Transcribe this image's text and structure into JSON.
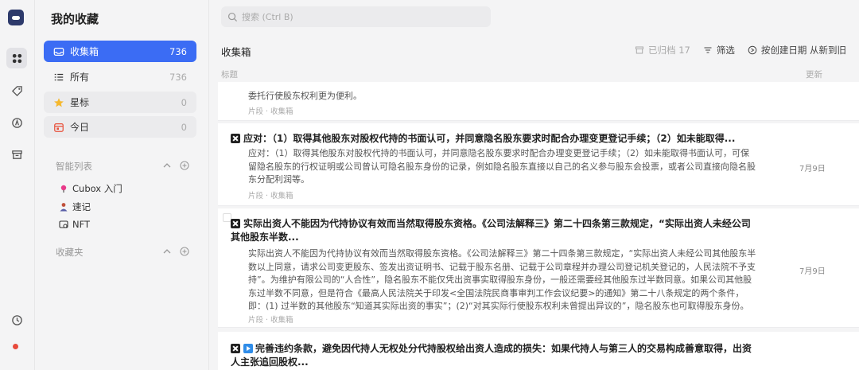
{
  "sidebar": {
    "title": "我的收藏",
    "items": [
      {
        "label": "收集箱",
        "count": "736"
      },
      {
        "label": "所有",
        "count": "736"
      },
      {
        "label": "星标",
        "count": "0"
      },
      {
        "label": "今日",
        "count": "0"
      }
    ],
    "smart_list_title": "智能列表",
    "smart_lists": [
      {
        "label": "Cubox 入门",
        "icon": "pin-icon"
      },
      {
        "label": "速记",
        "icon": "person-icon"
      },
      {
        "label": "NFT",
        "icon": "nft-icon"
      }
    ],
    "folders_title": "收藏夹"
  },
  "search": {
    "placeholder": "搜索 (Ctrl B)"
  },
  "main": {
    "title": "收集箱",
    "toolbar": {
      "archived": "已归档 17",
      "filter": "筛选",
      "sort": "按创建日期 从新到旧"
    },
    "col_title": "标题",
    "col_updated": "更新"
  },
  "cards": [
    {
      "body_partial": "委托行使股东权利更为便利。",
      "meta": "片段 · 收集箱"
    },
    {
      "title": "应对：（1）取得其他股东对股权代持的书面认可，并同意隐名股东要求时配合办理变更登记手续；（2）如未能取得...",
      "body": "应对：（1）取得其他股东对股权代持的书面认可，并同意隐名股东要求时配合办理变更登记手续；（2）如未能取得书面认可，可保留隐名股东的行权证明或公司曾认可隐名股东身份的记录，例如隐名股东直接以自己的名义参与股东会投票，或者公司直接向隐名股东分配利润等。",
      "meta": "片段 · 收集箱",
      "date": "7月9日"
    },
    {
      "title": "实际出资人不能因为代持协议有效而当然取得股东资格。《公司法解释三》第二十四条第三款规定，“实际出资人未经公司其他股东半数...",
      "body": "实际出资人不能因为代持协议有效而当然取得股东资格。《公司法解释三》第二十四条第三款规定，“实际出资人未经公司其他股东半数以上同意，请求公司变更股东、签发出资证明书、记载于股东名册、记载于公司章程并办理公司登记机关登记的，人民法院不予支持”。为维护有限公司的“人合性”，隐名股东不能仅凭出资事实取得股东身份，一般还需要经其他股东过半数同意。如果公司其他股东过半数不同意，但是符合《最高人民法院关于印发<全国法院民商事审判工作会议纪要>的通知》第二十八条规定的两个条件，即：(1) 过半数的其他股东“知道其实际出资的事实”；(2)“对其实际行使股东权利未曾提出异议的”，隐名股东也可取得股东身份。",
      "meta": "片段 · 收集箱",
      "date": "7月9日"
    },
    {
      "title": "完善违约条款，避免因代持人无权处分代持股权给出资人造成的损失：如果代持人与第三人的交易构成善意取得，出资人主张追回股权..."
    }
  ]
}
